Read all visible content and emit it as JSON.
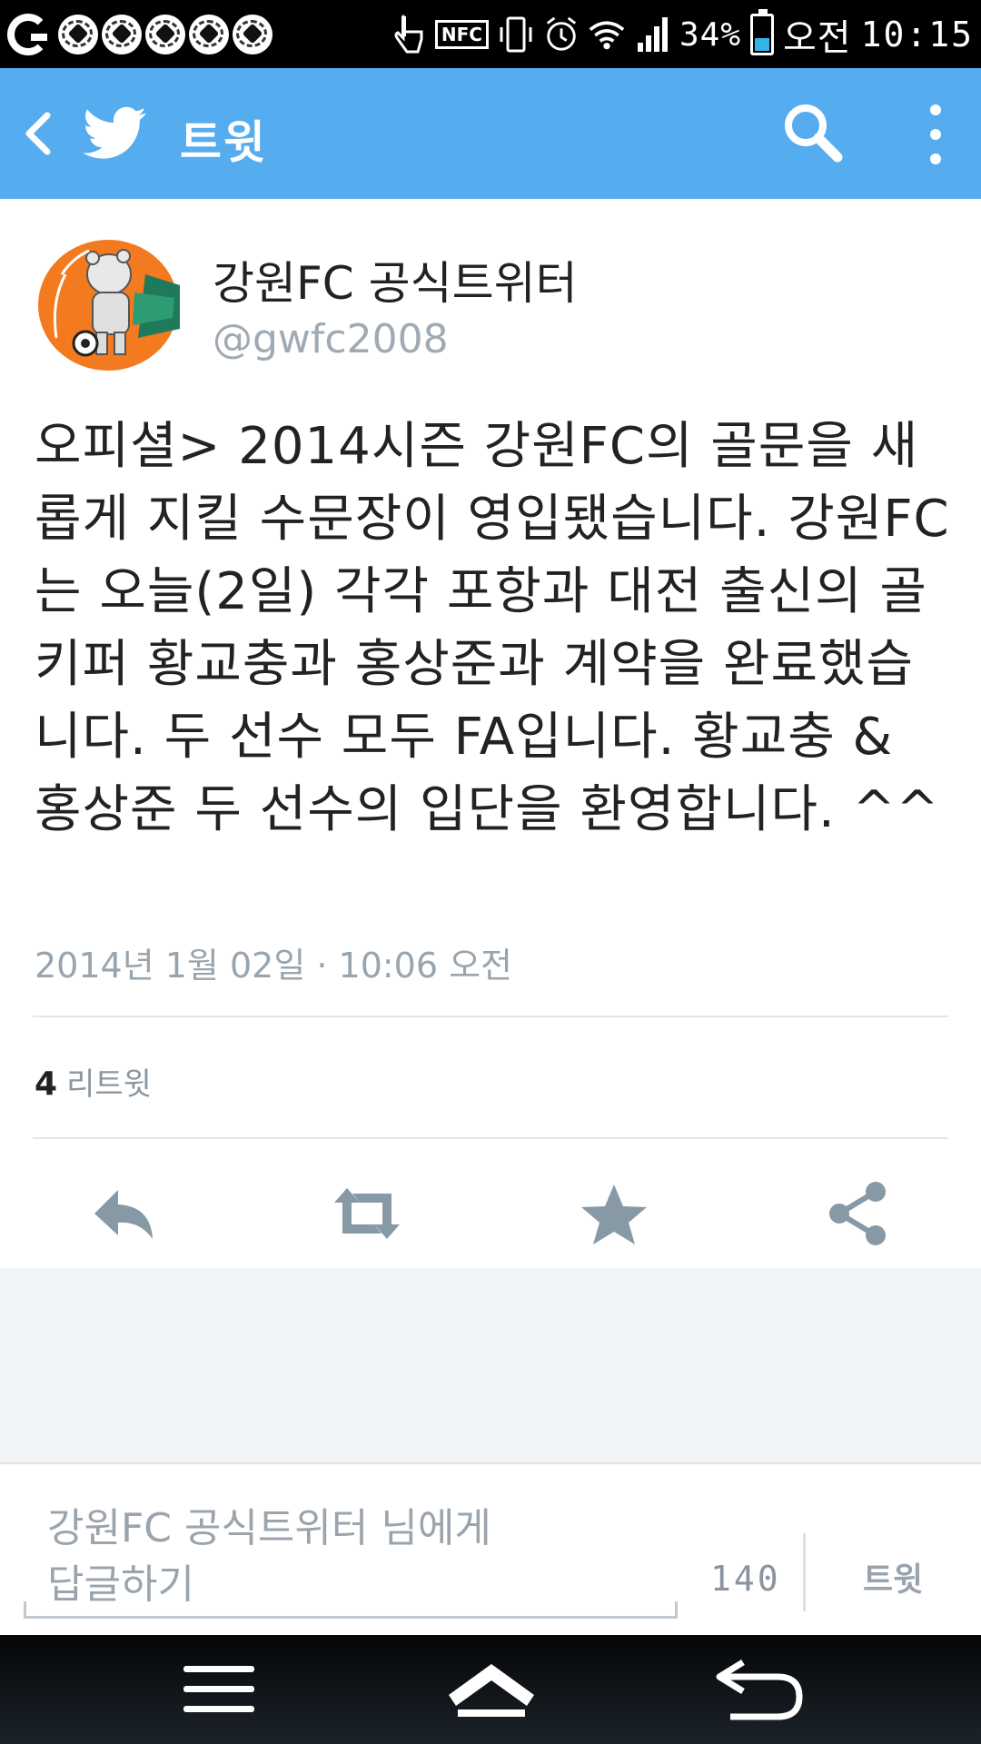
{
  "status_bar": {
    "nfc_label": "NFC",
    "battery_text": "34%",
    "battery_level": 0.34,
    "time_period": "오전",
    "time": "10:15",
    "soccer_notifications": 5
  },
  "app_bar": {
    "title": "트윗",
    "color": "#55acee"
  },
  "tweet": {
    "author_name": "강원FC 공식트위터",
    "author_handle": "@gwfc2008",
    "text": "오피셜> 2014시즌 강원FC의 골문을 새롭게 지킬 수문장이 영입됐습니다. 강원FC는 오늘(2일) 각각 포항과 대전 출신의 골키퍼 황교충과 홍상준과 계약을 완료했습니다. 두 선수 모두 FA입니다. 황교충 & 홍상준 두 선수의 입단을 환영합니다. ^^",
    "timestamp": "2014년 1월 02일 · 10:06 오전",
    "retweet_count": "4",
    "retweet_label": "리트윗"
  },
  "actions": {
    "icons": [
      "reply-icon",
      "retweet-icon",
      "favorite-icon",
      "share-icon"
    ],
    "color": "#8899a6"
  },
  "reply_bar": {
    "placeholder_line1": "강원FC 공식트위터 님에게",
    "placeholder_line2": "답글하기",
    "char_count": "140",
    "send_label": "트윗"
  },
  "nav_bar": {
    "icons": [
      "menu-icon",
      "home-icon",
      "back-icon"
    ]
  }
}
